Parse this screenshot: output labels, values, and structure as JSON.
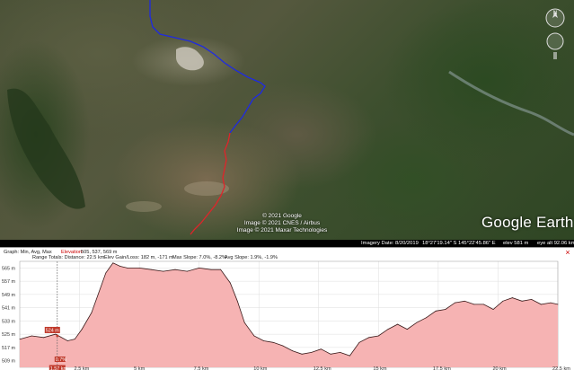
{
  "map": {
    "attribution": [
      "© 2021 Google",
      "Image © 2021 CNES / Airbus",
      "Image © 2021 Maxar Technologies"
    ],
    "logo": "Google Earth",
    "compass_letter": "N",
    "route_colors": {
      "upper": "#1f2be0",
      "lower": "#e0242a"
    }
  },
  "statusbar": {
    "imagery_date": "Imagery Date: 8/20/2019",
    "coords": "18°27'19.14\" S  145°22'45.86\" E",
    "elev": "elev  581 m",
    "eye_alt": "eye alt  92.06 km"
  },
  "profile": {
    "graph_label": "Graph: Min, Avg, Max",
    "elevation_label": "Elevation:",
    "elevation_values": "505, 537, 569 m",
    "range_totals": "Range Totals:  Distance: 22.5 km",
    "gain_loss": "Elev Gain/Loss: 182 m, -171 m",
    "max_slope": "Max Slope: 7.0%, -8.2%",
    "avg_slope": "Avg Slope: 1.9%, -1.9%",
    "close_icon": "×",
    "marker_elev": "524 m",
    "marker_slope": "0.7%",
    "marker_dist": "1.57 km",
    "colors": {
      "fill": "#f6b3b3",
      "line": "#3a1a1a",
      "marker": "#c0392b"
    }
  },
  "chart_data": {
    "type": "area",
    "title": "",
    "xlabel": "",
    "ylabel": "",
    "x_unit": "km",
    "y_unit": "m",
    "xlim": [
      0,
      22.5
    ],
    "ylim": [
      505,
      569
    ],
    "x_ticks": [
      "2.5 km",
      "5 km",
      "7.5 km",
      "10 km",
      "12.5 km",
      "15 km",
      "17.5 km",
      "20 km",
      "22.5 km"
    ],
    "x_tick_values": [
      2.5,
      5,
      7.5,
      10,
      12.5,
      15,
      17.5,
      20,
      22.5
    ],
    "y_ticks": [
      "565 m",
      "557 m",
      "549 m",
      "541 m",
      "533 m",
      "525 m",
      "517 m",
      "509 m"
    ],
    "y_tick_values": [
      565,
      557,
      549,
      541,
      533,
      525,
      517,
      509
    ],
    "x": [
      0,
      0.5,
      1.0,
      1.5,
      2.0,
      2.3,
      2.6,
      3.0,
      3.3,
      3.6,
      3.9,
      4.2,
      4.5,
      5.0,
      5.5,
      6.0,
      6.5,
      7.0,
      7.5,
      8.0,
      8.4,
      8.8,
      9.1,
      9.4,
      9.8,
      10.2,
      10.6,
      11.0,
      11.4,
      11.8,
      12.2,
      12.6,
      13.0,
      13.4,
      13.8,
      14.2,
      14.6,
      15.0,
      15.4,
      15.8,
      16.2,
      16.6,
      17.0,
      17.4,
      17.8,
      18.2,
      18.6,
      19.0,
      19.4,
      19.8,
      20.2,
      20.6,
      21.0,
      21.4,
      21.8,
      22.2,
      22.5
    ],
    "series": [
      {
        "values": [
          522,
          524,
          523,
          525,
          521,
          522,
          528,
          538,
          550,
          562,
          568,
          566,
          565,
          565,
          564,
          563,
          564,
          563,
          565,
          564,
          564,
          556,
          545,
          532,
          524,
          521,
          520,
          518,
          515,
          513,
          514,
          516,
          513,
          514,
          512,
          520,
          523,
          524,
          528,
          531,
          528,
          532,
          535,
          539,
          540,
          544,
          545,
          543,
          543,
          540,
          545,
          547,
          545,
          546,
          543,
          544,
          543
        ]
      }
    ],
    "marker": {
      "x": 1.57,
      "y": 524
    },
    "grid": true,
    "legend": "none"
  }
}
